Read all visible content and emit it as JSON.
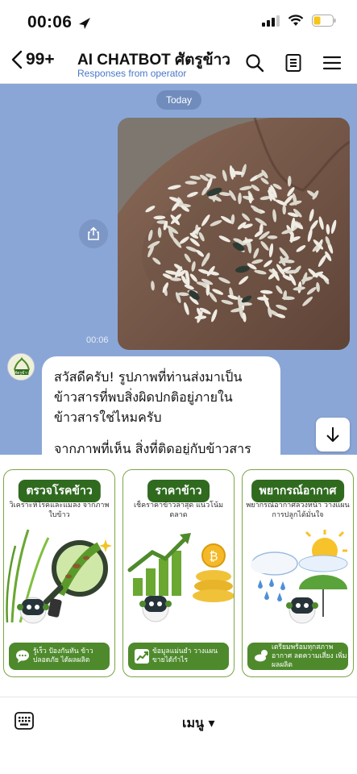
{
  "status": {
    "time": "00:06"
  },
  "header": {
    "unread_count": "99+",
    "title": "AI CHATBOT ศัตรูข้าว",
    "subtitle": "Responses from operator"
  },
  "chat": {
    "date_divider": "Today",
    "image_timestamp": "00:06",
    "bot_message_p1": "สวัสดีครับ! รูปภาพที่ท่านส่งมาเป็นข้าวสารที่พบสิ่งผิดปกติอยู่ภายในข้าวสารใช่ไหมครับ",
    "bot_message_p2": "จากภาพที่เห็น สิ่งที่ติดอยู่กับข้าวสาร",
    "avatar_text": "ศัตรูข้าว"
  },
  "rich_menu": {
    "cards": [
      {
        "title": "ตรวจโรคข้าว",
        "desc": "วิเคราะห์โรคและแมลง จากภาพใบข้าว",
        "footer": "รู้เร็ว ป้องกันทัน ข้าวปลอดภัย ได้ผลผลิต"
      },
      {
        "title": "ราคาข้าว",
        "desc": "เช็คราคาข้าวล่าสุด แนวโน้มตลาด",
        "footer": "ข้อมูลแม่นยำ วางแผนขายได้กำไร"
      },
      {
        "title": "พยากรณ์อากาศ",
        "desc": "พยากรณ์อากาศล่วงหน้า วางแผนการปลูกได้มั่นใจ",
        "footer": "เตรียมพร้อมทุกสภาพอากาศ ลดความเสี่ยง เพิ่มผลผลิต"
      }
    ]
  },
  "bottom_bar": {
    "menu_label": "เมนู ▾"
  },
  "colors": {
    "chat_bg": "#8aa6d6",
    "brand_green": "#2f6a1f",
    "subtitle_blue": "#4a77c8"
  }
}
